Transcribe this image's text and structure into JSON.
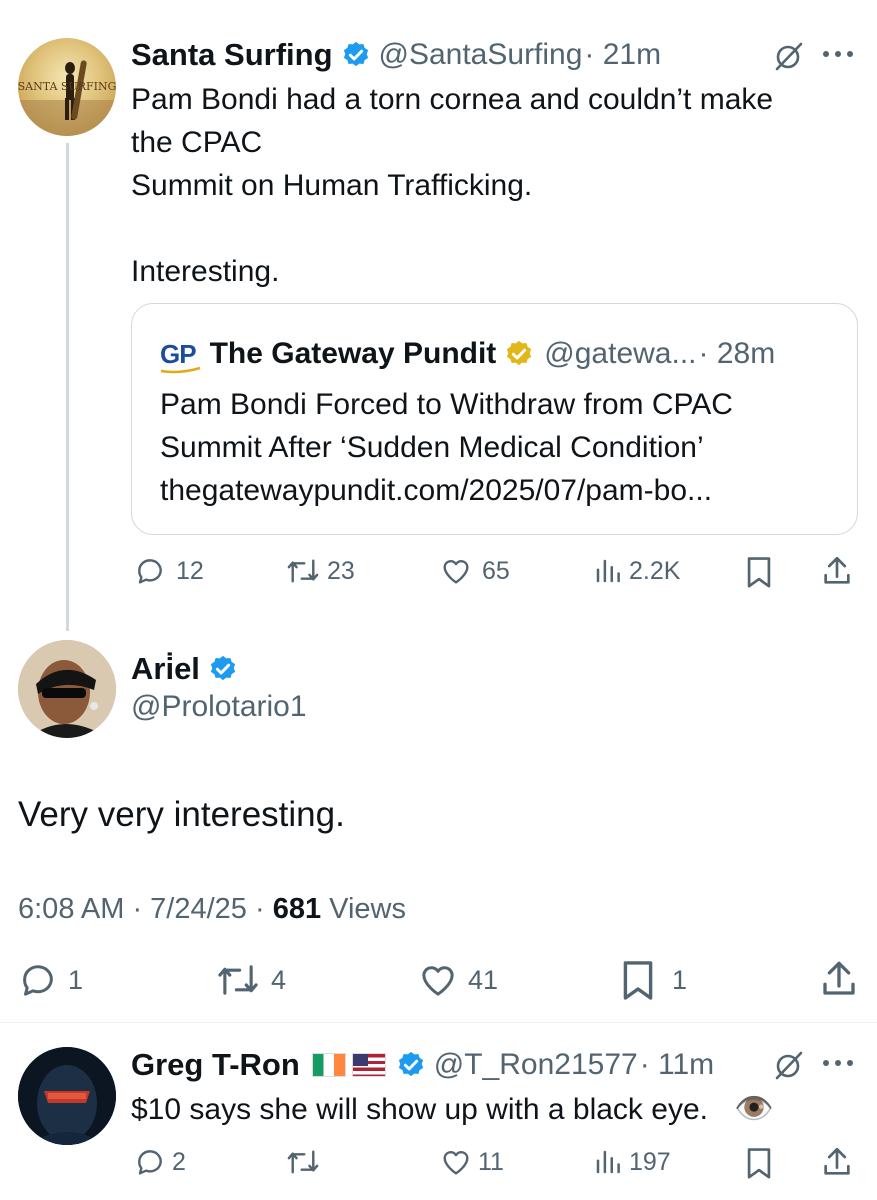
{
  "tweet1": {
    "display_name": "Santa Surfing",
    "handle": "@SantaSurfing",
    "time": "· 21m",
    "avatar_text": "SANTA SURFING",
    "lines": [
      "Pam Bondi had a torn cornea and couldn’t make",
      "the CPAC",
      "Summit on Human Trafficking.",
      "Interesting."
    ],
    "quote": {
      "logo": "GP",
      "display_name": "The Gateway Pundit",
      "handle": "@gatewa...",
      "time": "· 28m",
      "lines": [
        "Pam Bondi Forced to Withdraw from CPAC",
        "Summit After ‘Sudden Medical Condition’",
        "thegatewaypundit.com/2025/07/pam-bo..."
      ]
    },
    "stats": {
      "replies": "12",
      "retweets": "23",
      "likes": "65",
      "views": "2.2K"
    }
  },
  "tweet2": {
    "display_name": "Ari̇el",
    "handle": "@Prolotario1",
    "text": "Very very interesting.",
    "timestamp": "6:08 AM · 7/24/25 · ",
    "views_count": "681",
    "views_label": " Views",
    "stats": {
      "replies": "1",
      "retweets": "4",
      "likes": "41",
      "bookmarks": "1"
    }
  },
  "tweet3": {
    "display_name": "Greg T-Ron",
    "handle": "@T_Ron21577",
    "time": "· 11m",
    "text": "$10 says she will show up with a black eye.",
    "emoji": "👁️",
    "stats": {
      "replies": "2",
      "likes": "11",
      "views": "197"
    }
  },
  "colors": {
    "verified_blue": "#1d9bf0",
    "verified_gold": "#e2b719",
    "gray": "#536471",
    "gateway_blue": "#1a4e9c"
  }
}
